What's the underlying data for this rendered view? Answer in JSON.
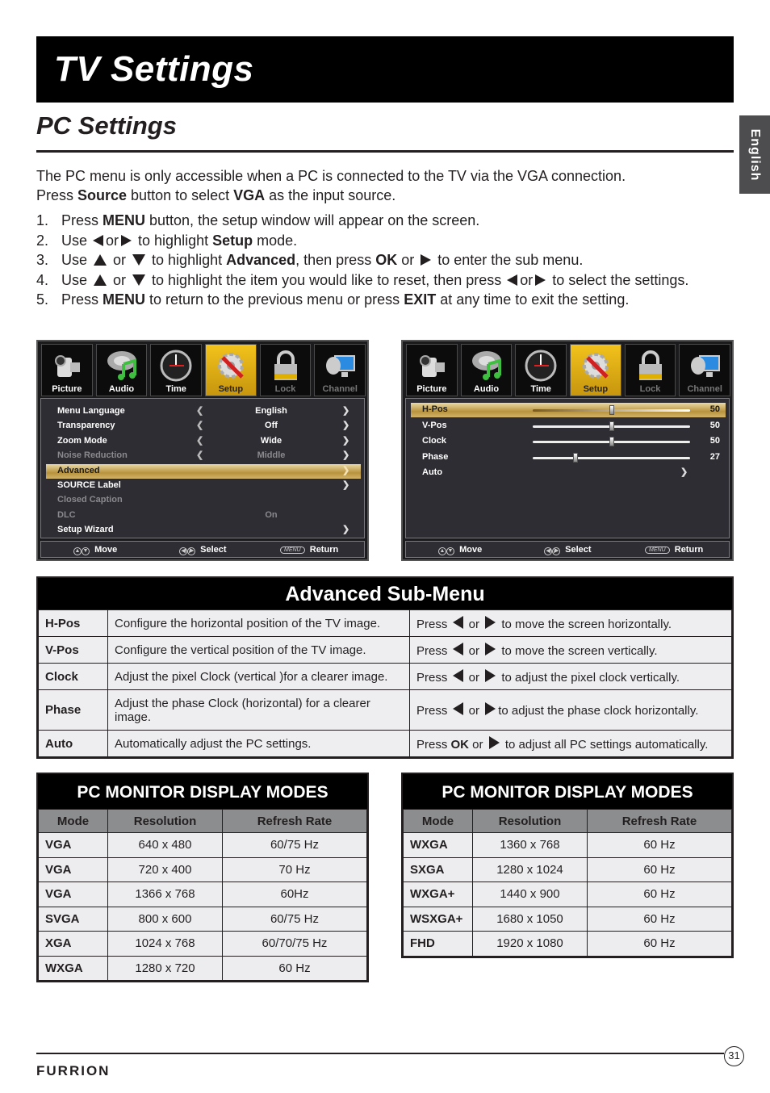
{
  "header": {
    "title": "TV Settings"
  },
  "section": {
    "title": "PC Settings",
    "language_tab": "English"
  },
  "intro": {
    "line1": "The PC menu is only accessible when a PC is connected to the TV via the VGA connection.",
    "line2_prefix": "Press ",
    "line2_bold1": "Source",
    "line2_mid": " button to select ",
    "line2_bold2": "VGA",
    "line2_suffix": " as the input source."
  },
  "steps": [
    {
      "num": "1.",
      "a": "Press ",
      "b": "MENU",
      "c": " button, the setup window will appear on the screen."
    },
    {
      "num": "2.",
      "a": "Use ",
      "or": "or",
      "c": " to highlight ",
      "b": "Setup",
      "d": " mode."
    },
    {
      "num": "3.",
      "a": "Use ",
      "or": " or ",
      "c": " to highlight ",
      "b": "Advanced",
      "d": ", then press ",
      "e": "OK",
      "or2": " or ",
      "f": " to enter the sub menu."
    },
    {
      "num": "4.",
      "a": "Use ",
      "or": " or ",
      "c": " to highlight the item you would like to reset, then press ",
      "or2": "or",
      "d": " to select the settings."
    },
    {
      "num": "5.",
      "a": "Press ",
      "b": "MENU",
      "c": " to return to the previous menu or press ",
      "e": "EXIT",
      "d": " at any time to exit the setting."
    }
  ],
  "osd": {
    "tabs": [
      {
        "label": "Picture",
        "icon": "camcorder-icon"
      },
      {
        "label": "Audio",
        "icon": "music-note-icon"
      },
      {
        "label": "Time",
        "icon": "clock-icon"
      },
      {
        "label": "Setup",
        "icon": "gear-wrench-icon"
      },
      {
        "label": "Lock",
        "icon": "padlock-icon"
      },
      {
        "label": "Channel",
        "icon": "satellite-monitor-icon"
      }
    ],
    "active_tab": "Setup",
    "setup_rows": [
      {
        "name": "Menu Language",
        "value": "English"
      },
      {
        "name": "Transparency",
        "value": "Off"
      },
      {
        "name": "Zoom Mode",
        "value": "Wide"
      },
      {
        "name": "Noise Reduction",
        "value": "Middle"
      },
      {
        "name": "Advanced",
        "value": ""
      },
      {
        "name": "SOURCE Label",
        "value": ""
      },
      {
        "name": "Closed Caption",
        "value": ""
      },
      {
        "name": "DLC",
        "value": "On"
      },
      {
        "name": "Setup Wizard",
        "value": ""
      }
    ],
    "advanced_rows": [
      {
        "name": "H-Pos",
        "value": 50
      },
      {
        "name": "V-Pos",
        "value": 50
      },
      {
        "name": "Clock",
        "value": 50
      },
      {
        "name": "Phase",
        "value": 27
      },
      {
        "name": "Auto",
        "value": ""
      }
    ],
    "slider_max": 100,
    "footer": {
      "move": "Move",
      "select": "Select",
      "menu_key": "MENU",
      "return": "Return"
    },
    "arrow_left": "<",
    "arrow_right": ">"
  },
  "advanced": {
    "title": "Advanced Sub-Menu",
    "rows": [
      {
        "item": "H-Pos",
        "desc": "Configure the horizontal position of the TV image.",
        "press": "Press ",
        "or": " or ",
        "action": " to move the screen horizontally."
      },
      {
        "item": "V-Pos",
        "desc": "Configure the vertical position of the TV image.",
        "press": "Press ",
        "or": " or ",
        "action": " to move the screen vertically."
      },
      {
        "item": "Clock",
        "desc": "Adjust the pixel Clock (vertical )for a clearer image.",
        "press": "Press ",
        "or": " or ",
        "action": " to adjust the pixel clock vertically."
      },
      {
        "item": "Phase",
        "desc": "Adjust the phase Clock (horizontal) for a clearer image.",
        "press": "Press ",
        "or": " or ",
        "action": "to adjust the phase clock horizontally."
      },
      {
        "item": "Auto",
        "desc": "Automatically adjust the PC settings.",
        "press": "Press ",
        "ok": "OK",
        "or": " or ",
        "action": " to adjust all PC settings automatically."
      }
    ]
  },
  "display_modes": [
    {
      "title": "PC MONITOR DISPLAY MODES",
      "headers": [
        "Mode",
        "Resolution",
        "Refresh Rate"
      ],
      "rows": [
        [
          "VGA",
          "640 x 480",
          "60/75 Hz"
        ],
        [
          "VGA",
          "720 x 400",
          "70 Hz"
        ],
        [
          "VGA",
          "1366 x 768",
          "60Hz"
        ],
        [
          "SVGA",
          "800 x 600",
          "60/75 Hz"
        ],
        [
          "XGA",
          "1024 x 768",
          "60/70/75 Hz"
        ],
        [
          "WXGA",
          "1280 x 720",
          "60 Hz"
        ]
      ]
    },
    {
      "title": "PC MONITOR DISPLAY MODES",
      "headers": [
        "Mode",
        "Resolution",
        "Refresh Rate"
      ],
      "rows": [
        [
          "WXGA",
          "1360 x 768",
          "60 Hz"
        ],
        [
          "SXGA",
          "1280 x 1024",
          "60 Hz"
        ],
        [
          "WXGA+",
          "1440 x 900",
          "60 Hz"
        ],
        [
          "WSXGA+",
          "1680 x 1050",
          "60 Hz"
        ],
        [
          "FHD",
          "1920 x 1080",
          "60 Hz"
        ]
      ]
    }
  ],
  "footer": {
    "page_number": "31",
    "brand": "FURRION"
  }
}
